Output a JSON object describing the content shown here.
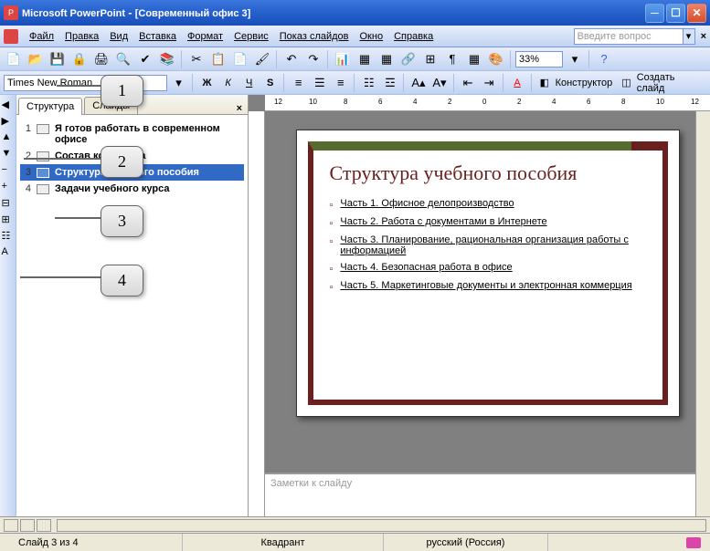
{
  "window": {
    "app": "Microsoft PowerPoint",
    "doc": "[Современный офис 3]"
  },
  "menu": {
    "file": "Файл",
    "edit": "Правка",
    "view": "Вид",
    "insert": "Вставка",
    "format": "Формат",
    "tools": "Сервис",
    "slideshow": "Показ слайдов",
    "window": "Окно",
    "help": "Справка",
    "helpbox": "Введите вопрос"
  },
  "toolbar": {
    "zoom": "33%",
    "font": "Times New Roman",
    "designer": "Конструктор",
    "newslide": "Создать слайд"
  },
  "tabs": {
    "outline": "Структура",
    "slides": "Слайды"
  },
  "outline": {
    "items": [
      {
        "n": "1",
        "title": "Я готов работать в современном офисе"
      },
      {
        "n": "2",
        "title": "Состав комплекса"
      },
      {
        "n": "3",
        "title": "Структура учебного пособия"
      },
      {
        "n": "4",
        "title": "Задачи учебного курса"
      }
    ],
    "selected": 2
  },
  "slide": {
    "title": "Структура учебного пособия",
    "bullets": [
      "Часть 1. Офисное делопроизводство",
      "Часть 2. Работа с документами в Интернете",
      "Часть 3. Планирование, рациональная организация работы с информацией",
      "Часть 4. Безопасная работа в офисе",
      "Часть 5. Маркетинговые документы и электронная коммерция"
    ]
  },
  "notes": {
    "placeholder": "Заметки к слайду"
  },
  "status": {
    "slide": "Слайд 3 из 4",
    "template": "Квадрант",
    "lang": "русский (Россия)"
  },
  "ruler": {
    "ticks": [
      "12",
      "10",
      "8",
      "6",
      "4",
      "2",
      "0",
      "2",
      "4",
      "6",
      "8",
      "10",
      "12"
    ]
  },
  "callouts": {
    "c1": "1",
    "c2": "2",
    "c3": "3",
    "c4": "4"
  }
}
